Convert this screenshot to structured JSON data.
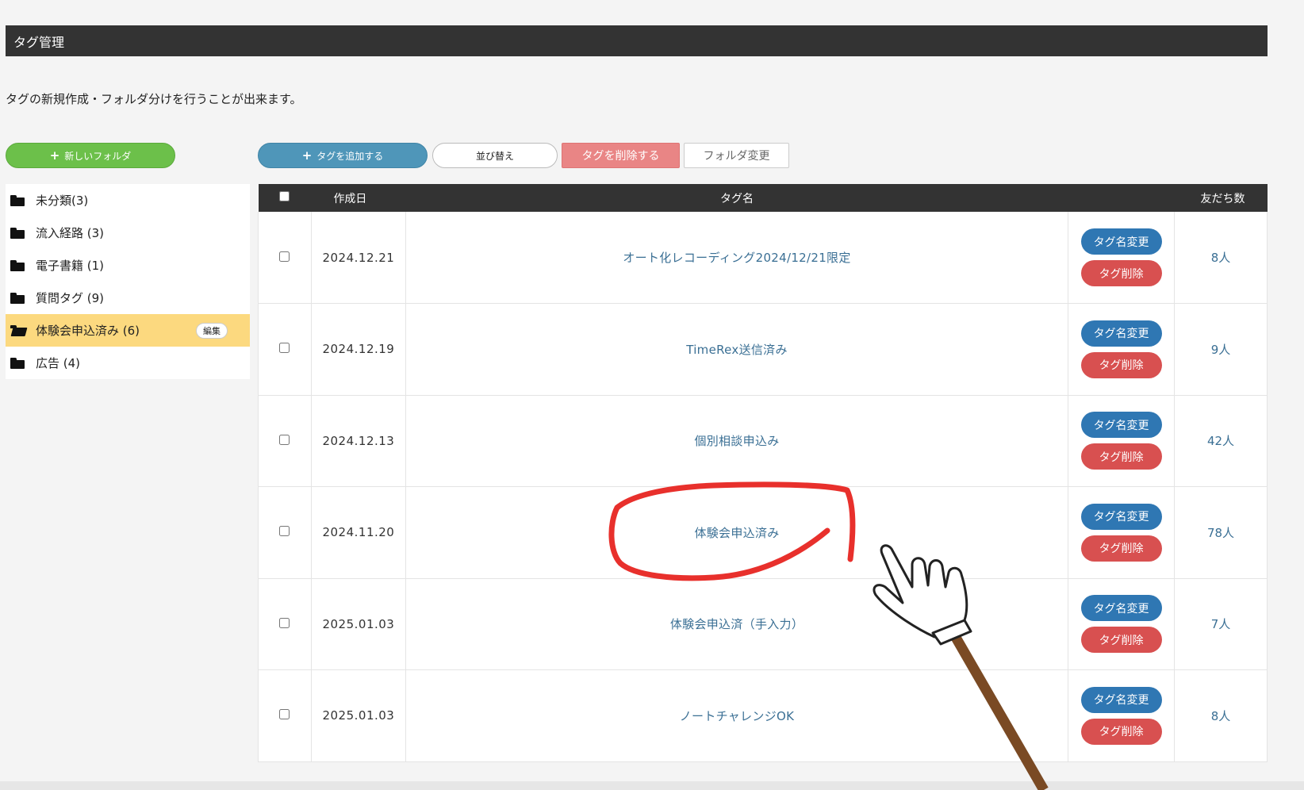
{
  "header": {
    "title": "タグ管理"
  },
  "description": "タグの新規作成・フォルダ分けを行うことが出来ます。",
  "sidebar": {
    "new_folder_label": "新しいフォルダ",
    "items": [
      {
        "label": "未分類(3)"
      },
      {
        "label": "流入経路 (3)"
      },
      {
        "label": "電子書籍 (1)"
      },
      {
        "label": "質問タグ (9)"
      },
      {
        "label": "体験会申込済み (6)",
        "edit_label": "編集",
        "active": true
      },
      {
        "label": "広告 (4)"
      }
    ]
  },
  "toolbar": {
    "add_tag_label": "タグを追加する",
    "sort_label": "並び替え",
    "delete_tags_label": "タグを削除する",
    "change_folder_label": "フォルダ変更"
  },
  "table": {
    "columns": {
      "date": "作成日",
      "name": "タグ名",
      "friends": "友だち数"
    },
    "rename_label": "タグ名変更",
    "delete_label": "タグ削除",
    "rows": [
      {
        "date": "2024.12.21",
        "name": "オート化レコーディング2024/12/21限定",
        "friends": "8人"
      },
      {
        "date": "2024.12.19",
        "name": "TimeRex送信済み",
        "friends": "9人"
      },
      {
        "date": "2024.12.13",
        "name": "個別相談申込み",
        "friends": "42人"
      },
      {
        "date": "2024.11.20",
        "name": "体験会申込済み",
        "friends": "78人"
      },
      {
        "date": "2025.01.03",
        "name": "体験会申込済（手入力）",
        "friends": "7人"
      },
      {
        "date": "2025.01.03",
        "name": "ノートチャレンジOK",
        "friends": "8人"
      }
    ]
  },
  "colors": {
    "header_bg": "#333333",
    "active_folder": "#fcd97f",
    "add_folder_green": "#6cc04a",
    "add_tag_blue": "#4f96b9",
    "rename_blue": "#2f77b3",
    "delete_red": "#d85050",
    "annotation_red": "#e8302c"
  }
}
